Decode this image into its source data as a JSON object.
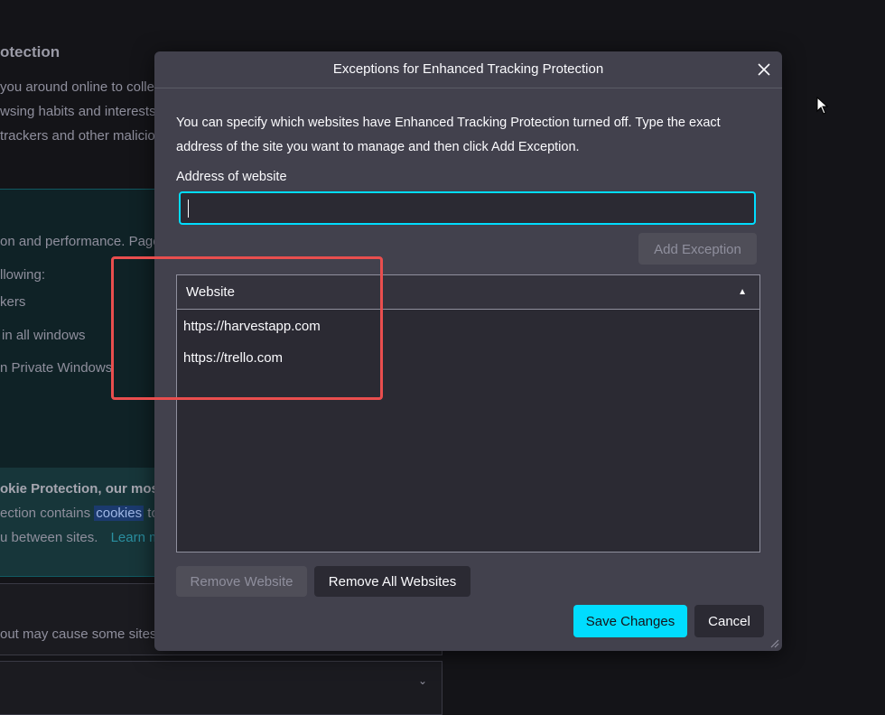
{
  "background": {
    "heading": "otection",
    "lines": [
      "you around online to colle",
      "wsing habits and interests.",
      "trackers and other malicio",
      "on and performance. Page",
      "llowing:",
      "kers",
      "in all windows",
      "n Private Windows"
    ],
    "cookie_bold": "okie Protection, our mos",
    "cookie_line1_pre": "ection contains",
    "cookie_highlight": "cookies",
    "cookie_line1_post": "to",
    "cookie_line2": "u between sites.",
    "cookie_link": "Learn m",
    "card_text": "out may cause some sites c"
  },
  "dialog": {
    "title": "Exceptions for Enhanced Tracking Protection",
    "description_line1": "You can specify which websites have Enhanced Tracking Protection turned off. Type the exact",
    "description_line2": "address of the site you want to manage and then click Add Exception.",
    "address_label": "Address of website",
    "address_value": "",
    "add_exception_label": "Add Exception",
    "table": {
      "column_header": "Website",
      "rows": [
        "https://harvestapp.com",
        "https://trello.com"
      ]
    },
    "remove_website_label": "Remove Website",
    "remove_all_label": "Remove All Websites",
    "save_label": "Save Changes",
    "cancel_label": "Cancel"
  },
  "colors": {
    "dialog_bg": "#42414d",
    "accent": "#00ddff",
    "annotation": "#e94e4e"
  },
  "icons": [
    "close-icon",
    "sort-ascending-icon",
    "chevron-down-icon",
    "mouse-cursor-icon",
    "resize-grip-icon"
  ]
}
